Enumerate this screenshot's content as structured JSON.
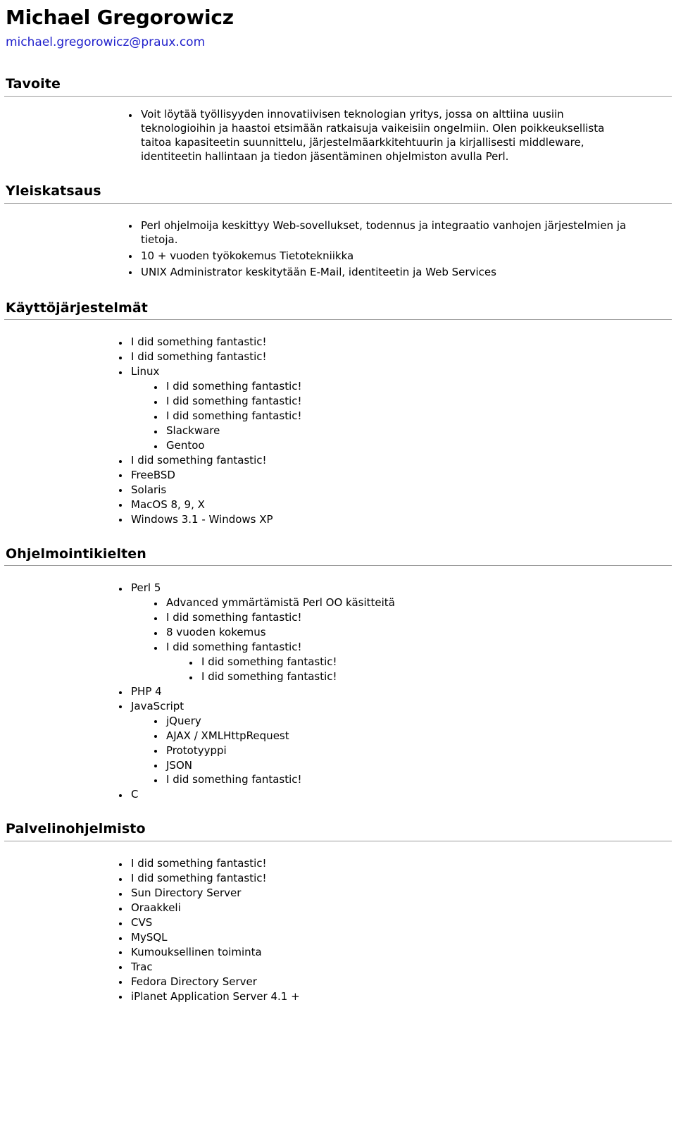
{
  "header": {
    "name": "Michael Gregorowicz",
    "email": "michael.gregorowicz@praux.com"
  },
  "sections": [
    {
      "id": "tavoite",
      "title": "Tavoite",
      "items": [
        {
          "text": "Voit löytää työllisyyden innovatiivisen teknologian yritys, jossa on alttiina uusiin teknologioihin ja haastoi etsimään ratkaisuja vaikeisiin ongelmiin. Olen poikkeuksellista taitoa kapasiteetin suunnittelu, järjestelmäarkkitehtuurin ja kirjallisesti middleware, identiteetin hallintaan ja tiedon jäsentäminen ohjelmiston avulla Perl."
        }
      ]
    },
    {
      "id": "yleiskatsaus",
      "title": "Yleiskatsaus",
      "items": [
        {
          "text": "Perl ohjelmoija keskittyy Web-sovellukset, todennus ja integraatio vanhojen järjestelmien ja tietoja."
        },
        {
          "text": "10 + vuoden työkokemus Tietotekniikka"
        },
        {
          "text": "UNIX Administrator keskitytään E-Mail, identiteetin ja Web Services"
        }
      ]
    },
    {
      "id": "os",
      "title": "Käyttöjärjestelmät",
      "items": [
        {
          "text": "I did something fantastic!"
        },
        {
          "text": "I did something fantastic!"
        },
        {
          "text": "Linux",
          "children": [
            {
              "text": "I did something fantastic!"
            },
            {
              "text": "I did something fantastic!"
            },
            {
              "text": "I did something fantastic!"
            },
            {
              "text": "Slackware"
            },
            {
              "text": "Gentoo"
            }
          ]
        },
        {
          "text": "I did something fantastic!"
        },
        {
          "text": "FreeBSD"
        },
        {
          "text": "Solaris"
        },
        {
          "text": "MacOS 8, 9, X"
        },
        {
          "text": "Windows 3.1 - Windows XP"
        }
      ]
    },
    {
      "id": "langs",
      "title": "Ohjelmointikielten",
      "items": [
        {
          "text": "Perl 5",
          "children": [
            {
              "text": "Advanced ymmärtämistä Perl OO käsitteitä"
            },
            {
              "text": "I did something fantastic!"
            },
            {
              "text": "8 vuoden kokemus"
            },
            {
              "text": "I did something fantastic!",
              "children": [
                {
                  "text": "I did something fantastic!"
                },
                {
                  "text": "I did something fantastic!"
                }
              ]
            }
          ]
        },
        {
          "text": "PHP 4"
        },
        {
          "text": "JavaScript",
          "children": [
            {
              "text": "jQuery"
            },
            {
              "text": "AJAX / XMLHttpRequest"
            },
            {
              "text": "Prototyyppi"
            },
            {
              "text": "JSON"
            },
            {
              "text": "I did something fantastic!"
            }
          ]
        },
        {
          "text": "C"
        }
      ]
    },
    {
      "id": "server",
      "title": "Palvelinohjelmisto",
      "items": [
        {
          "text": "I did something fantastic!"
        },
        {
          "text": "I did something fantastic!"
        },
        {
          "text": "Sun Directory Server"
        },
        {
          "text": "Oraakkeli"
        },
        {
          "text": "CVS"
        },
        {
          "text": "MySQL"
        },
        {
          "text": "Kumouksellinen toiminta"
        },
        {
          "text": "Trac"
        },
        {
          "text": "Fedora Directory Server"
        },
        {
          "text": "iPlanet Application Server 4.1 +"
        }
      ]
    }
  ],
  "colors": {
    "link": "#2222cc",
    "rule": "#9a9a9a",
    "text": "#000000"
  }
}
